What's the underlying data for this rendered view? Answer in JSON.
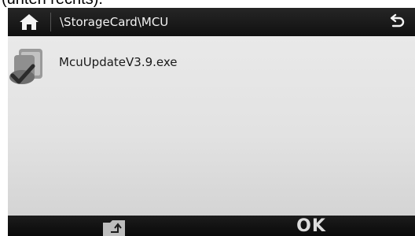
{
  "caption": "(unten rechts).",
  "titlebar": {
    "path": "\\StorageCard\\MCU",
    "home_icon": "home-icon",
    "back_icon": "back-arrow-icon"
  },
  "files": [
    {
      "name": "McuUpdateV3.9.exe",
      "icon": "executable-file-icon"
    }
  ],
  "bottombar": {
    "upload_icon": "folder-up-icon",
    "ok_label": "OK"
  },
  "colors": {
    "bar": "#111111",
    "list_background": "#e4e4e4",
    "text_light": "#f2f2f2",
    "text_dark": "#1a1a1a"
  }
}
